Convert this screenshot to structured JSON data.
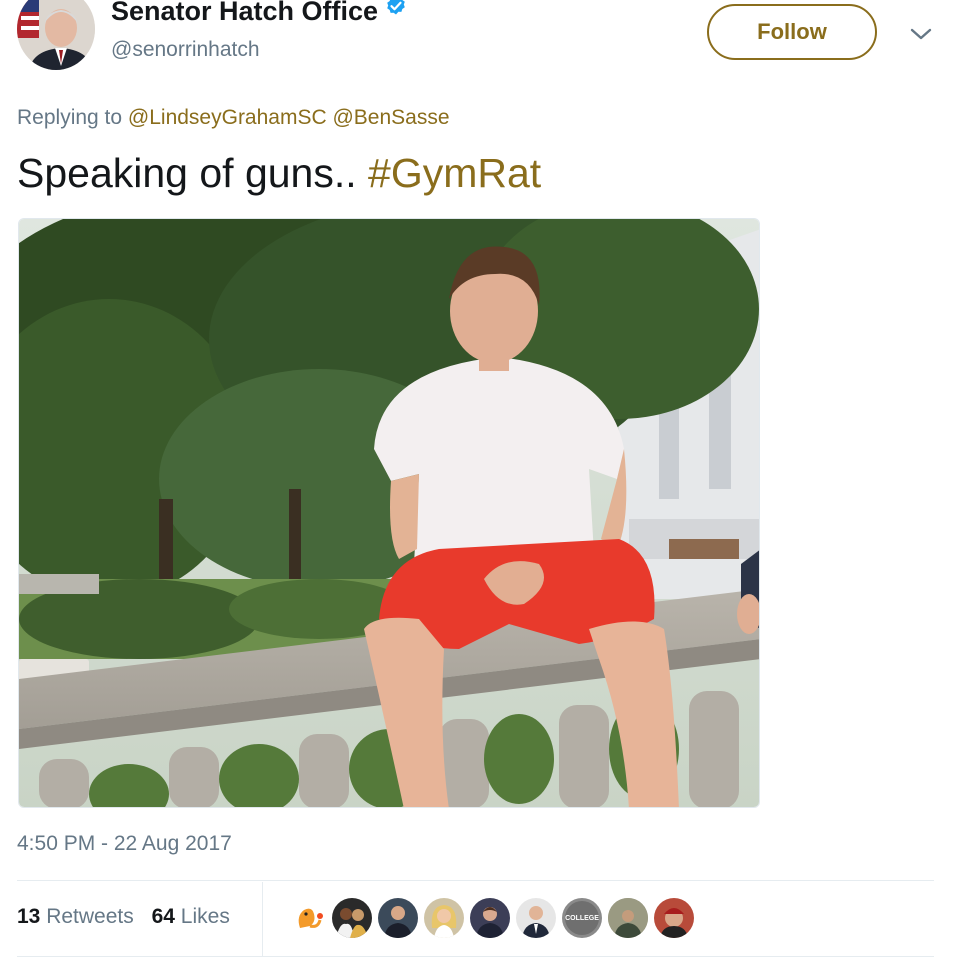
{
  "header": {
    "display_name": "Senator Hatch Office",
    "handle": "@senorrinhatch",
    "follow_label": "Follow"
  },
  "reply": {
    "prefix": "Replying to",
    "mentions": [
      "@LindseyGrahamSC",
      "@BenSasse"
    ]
  },
  "tweet": {
    "text": "Speaking of guns..",
    "hashtag": "#GymRat"
  },
  "meta": {
    "timestamp": "4:50 PM - 22 Aug 2017"
  },
  "stats": {
    "retweets_count": "13",
    "retweets_label": "Retweets",
    "likes_count": "64",
    "likes_label": "Likes"
  },
  "liker_avatar_caption": "COLLEGE",
  "colors": {
    "accent": "#8a6d1c",
    "verified": "#1da1f2",
    "secondary_text": "#657786"
  },
  "icons": [
    "verified-badge-icon",
    "chevron-down-icon"
  ]
}
